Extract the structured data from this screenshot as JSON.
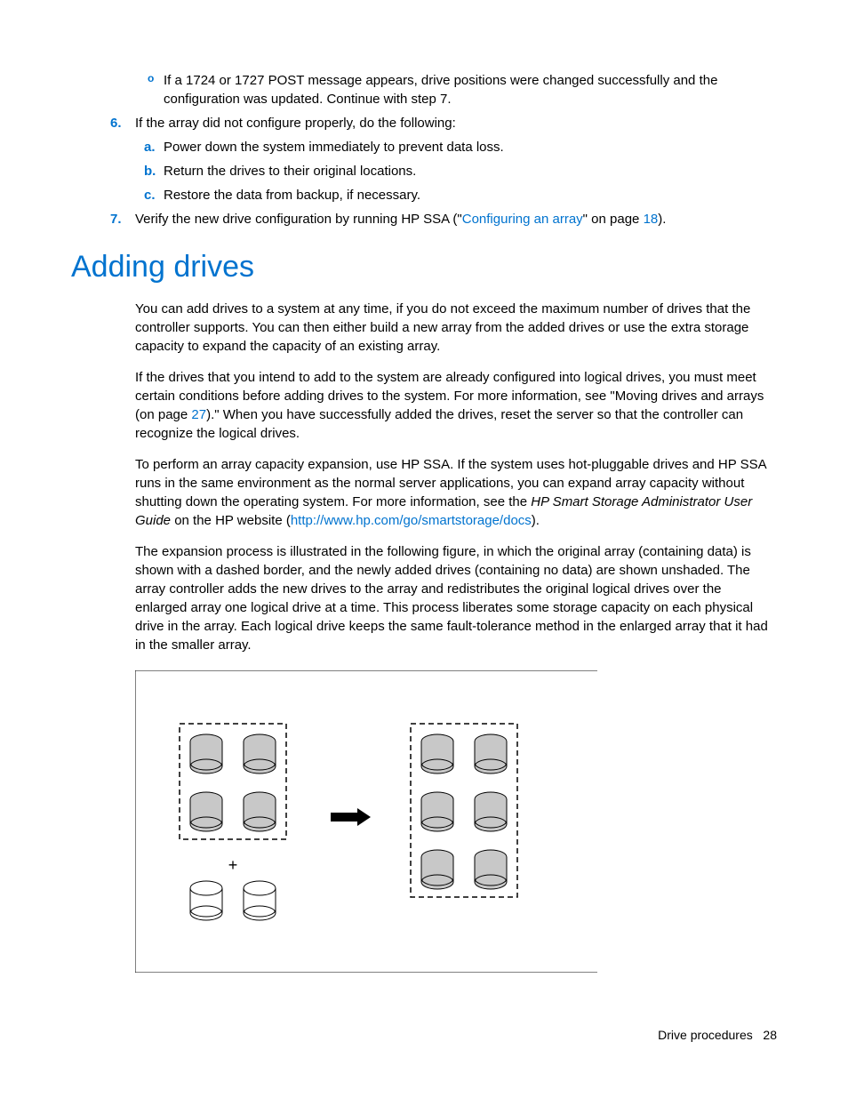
{
  "list1": {
    "bullet_o_marker": "o",
    "bullet_o_text": "If a 1724 or 1727 POST message appears, drive positions were changed successfully and the configuration was updated. Continue with step 7.",
    "item6_marker": "6.",
    "item6_text": "If the array did not configure properly, do the following:",
    "item6_a_marker": "a.",
    "item6_a_text": "Power down the system immediately to prevent data loss.",
    "item6_b_marker": "b.",
    "item6_b_text": "Return the drives to their original locations.",
    "item6_c_marker": "c.",
    "item6_c_text": "Restore the data from backup, if necessary.",
    "item7_marker": "7.",
    "item7_text_pre": "Verify the new drive configuration by running HP SSA (\"",
    "item7_link": "Configuring an array",
    "item7_text_mid": "\" on page ",
    "item7_page": "18",
    "item7_text_post": ")."
  },
  "heading": "Adding drives",
  "para1": "You can add drives to a system at any time, if you do not exceed the maximum number of drives that the controller supports. You can then either build a new array from the added drives or use the extra storage capacity to expand the capacity of an existing array.",
  "para2_pre": "If the drives that you intend to add to the system are already configured into logical drives, you must meet certain conditions before adding drives to the system. For more information, see \"Moving drives and arrays (on page ",
  "para2_page": "27",
  "para2_post": ").\" When you have successfully added the drives, reset the server so that the controller can recognize the logical drives.",
  "para3_pre": "To perform an array capacity expansion, use HP SSA. If the system uses hot-pluggable drives and HP SSA runs in the same environment as the normal server applications, you can expand array capacity without shutting down the operating system. For more information, see the ",
  "para3_italic": "HP Smart Storage Administrator User Guide",
  "para3_mid": " on the HP website (",
  "para3_link": "http://www.hp.com/go/smartstorage/docs",
  "para3_post": ").",
  "para4": "The expansion process is illustrated in the following figure, in which the original array (containing data) is shown with a dashed border, and the newly added drives (containing no data) are shown unshaded. The array controller adds the new drives to the array and redistributes the original logical drives over the enlarged array one logical drive at a time. This process liberates some storage capacity on each physical drive in the array. Each logical drive keeps the same fault-tolerance method in the enlarged array that it had in the smaller array.",
  "footer_section": "Drive procedures",
  "footer_page": "28"
}
